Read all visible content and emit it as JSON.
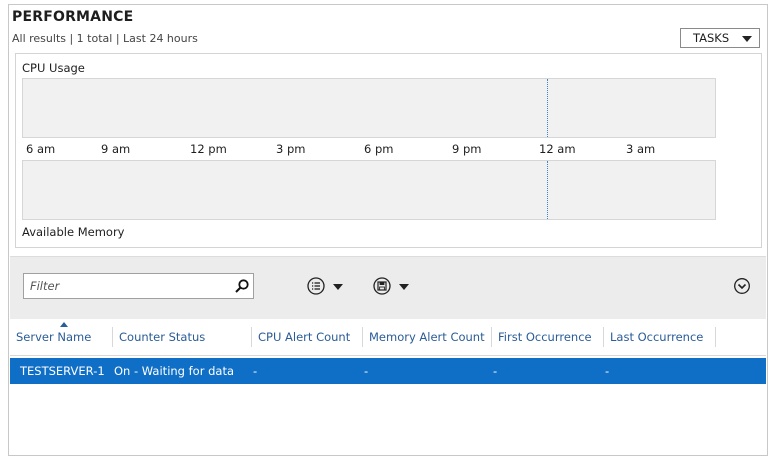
{
  "header": {
    "title": "PERFORMANCE",
    "subtitle": "All results | 1 total  |  Last 24 hours",
    "tasks_label": "TASKS"
  },
  "charts": {
    "cpu_label": "CPU Usage",
    "memory_label": "Available Memory",
    "time_ticks": [
      "6 am",
      "9 am",
      "12 pm",
      "3 pm",
      "6 pm",
      "9 pm",
      "12 am",
      "3 am"
    ]
  },
  "toolbar": {
    "filter_placeholder": "Filter",
    "icons": {
      "search": "search-icon",
      "list_options": "list-icon",
      "save_query": "save-icon",
      "expand": "chevron-down-circle-icon"
    }
  },
  "grid": {
    "columns": [
      "Server Name",
      "Counter Status",
      "CPU Alert Count",
      "Memory Alert Count",
      "First Occurrence",
      "Last Occurrence"
    ],
    "sorted_column": "Server Name",
    "rows": [
      [
        "TESTSERVER-1",
        "On - Waiting for data",
        "-",
        "-",
        "-",
        "-"
      ]
    ]
  },
  "colors": {
    "selection": "#0f6fc6",
    "header_link": "#2a5c97",
    "plot_background": "#f1f1f1",
    "now_marker": "#3a86c8",
    "toolbar_background": "#ececec"
  }
}
